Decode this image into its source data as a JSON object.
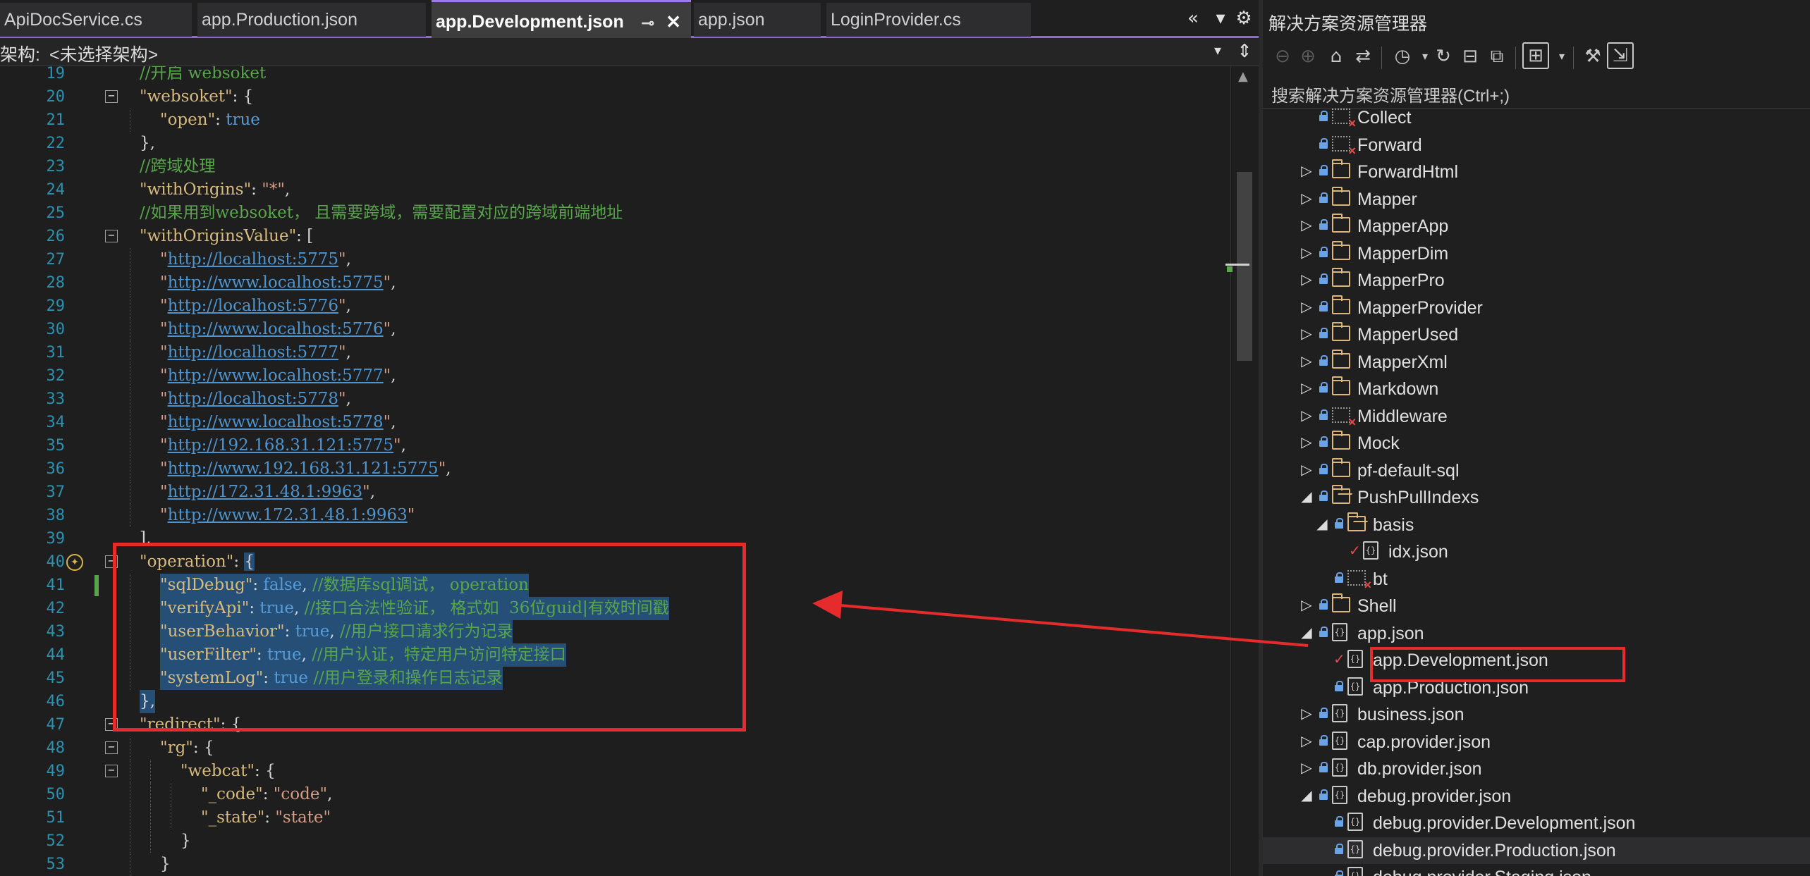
{
  "tabs": [
    {
      "label": "ApiDocService.cs",
      "active": false
    },
    {
      "label": "app.Production.json",
      "active": false
    },
    {
      "label": "app.Development.json",
      "active": true
    },
    {
      "label": "app.json",
      "active": false
    },
    {
      "label": "LoginProvider.cs",
      "active": false
    }
  ],
  "tab_controls": {
    "overflow": "«",
    "dropdown": "▾",
    "settings": "⚙"
  },
  "arch_bar": {
    "label": "架构:",
    "value": "<未选择架构>"
  },
  "code_lines": [
    {
      "n": "19",
      "fold": false,
      "indent": 1,
      "parts": [
        {
          "t": "//开启 websoket",
          "c": "com"
        }
      ]
    },
    {
      "n": "20",
      "fold": true,
      "indent": 1,
      "parts": [
        {
          "t": "\"websoket\"",
          "c": "key"
        },
        {
          "t": ": {",
          "c": "pun"
        }
      ]
    },
    {
      "n": "21",
      "fold": false,
      "indent": 2,
      "parts": [
        {
          "t": "\"open\"",
          "c": "key"
        },
        {
          "t": ": ",
          "c": "pun"
        },
        {
          "t": "true",
          "c": "val"
        }
      ]
    },
    {
      "n": "22",
      "fold": false,
      "indent": 1,
      "parts": [
        {
          "t": "},",
          "c": "pun"
        }
      ]
    },
    {
      "n": "23",
      "fold": false,
      "indent": 1,
      "parts": [
        {
          "t": "//跨域处理",
          "c": "com"
        }
      ]
    },
    {
      "n": "24",
      "fold": false,
      "indent": 1,
      "parts": [
        {
          "t": "\"withOrigins\"",
          "c": "key"
        },
        {
          "t": ": ",
          "c": "pun"
        },
        {
          "t": "\"*\"",
          "c": "str"
        },
        {
          "t": ",",
          "c": "pun"
        }
      ]
    },
    {
      "n": "25",
      "fold": false,
      "indent": 1,
      "parts": [
        {
          "t": "//如果用到websoket， 且需要跨域，需要配置对应的跨域前端地址",
          "c": "com"
        }
      ]
    },
    {
      "n": "26",
      "fold": true,
      "indent": 1,
      "parts": [
        {
          "t": "\"withOriginsValue\"",
          "c": "key"
        },
        {
          "t": ": [",
          "c": "pun"
        }
      ]
    },
    {
      "n": "27",
      "fold": false,
      "indent": 2,
      "parts": [
        {
          "t": "\"",
          "c": "str"
        },
        {
          "t": "http://localhost:5775",
          "c": "url"
        },
        {
          "t": "\"",
          "c": "str"
        },
        {
          "t": ",",
          "c": "pun"
        }
      ]
    },
    {
      "n": "28",
      "fold": false,
      "indent": 2,
      "parts": [
        {
          "t": "\"",
          "c": "str"
        },
        {
          "t": "http://www.localhost:5775",
          "c": "url"
        },
        {
          "t": "\"",
          "c": "str"
        },
        {
          "t": ",",
          "c": "pun"
        }
      ]
    },
    {
      "n": "29",
      "fold": false,
      "indent": 2,
      "parts": [
        {
          "t": "\"",
          "c": "str"
        },
        {
          "t": "http://localhost:5776",
          "c": "url"
        },
        {
          "t": "\"",
          "c": "str"
        },
        {
          "t": ",",
          "c": "pun"
        }
      ]
    },
    {
      "n": "30",
      "fold": false,
      "indent": 2,
      "parts": [
        {
          "t": "\"",
          "c": "str"
        },
        {
          "t": "http://www.localhost:5776",
          "c": "url"
        },
        {
          "t": "\"",
          "c": "str"
        },
        {
          "t": ",",
          "c": "pun"
        }
      ]
    },
    {
      "n": "31",
      "fold": false,
      "indent": 2,
      "parts": [
        {
          "t": "\"",
          "c": "str"
        },
        {
          "t": "http://localhost:5777",
          "c": "url"
        },
        {
          "t": "\"",
          "c": "str"
        },
        {
          "t": ",",
          "c": "pun"
        }
      ]
    },
    {
      "n": "32",
      "fold": false,
      "indent": 2,
      "parts": [
        {
          "t": "\"",
          "c": "str"
        },
        {
          "t": "http://www.localhost:5777",
          "c": "url"
        },
        {
          "t": "\"",
          "c": "str"
        },
        {
          "t": ",",
          "c": "pun"
        }
      ]
    },
    {
      "n": "33",
      "fold": false,
      "indent": 2,
      "parts": [
        {
          "t": "\"",
          "c": "str"
        },
        {
          "t": "http://localhost:5778",
          "c": "url"
        },
        {
          "t": "\"",
          "c": "str"
        },
        {
          "t": ",",
          "c": "pun"
        }
      ]
    },
    {
      "n": "34",
      "fold": false,
      "indent": 2,
      "parts": [
        {
          "t": "\"",
          "c": "str"
        },
        {
          "t": "http://www.localhost:5778",
          "c": "url"
        },
        {
          "t": "\"",
          "c": "str"
        },
        {
          "t": ",",
          "c": "pun"
        }
      ]
    },
    {
      "n": "35",
      "fold": false,
      "indent": 2,
      "parts": [
        {
          "t": "\"",
          "c": "str"
        },
        {
          "t": "http://192.168.31.121:5775",
          "c": "url"
        },
        {
          "t": "\"",
          "c": "str"
        },
        {
          "t": ",",
          "c": "pun"
        }
      ]
    },
    {
      "n": "36",
      "fold": false,
      "indent": 2,
      "parts": [
        {
          "t": "\"",
          "c": "str"
        },
        {
          "t": "http://www.192.168.31.121:5775",
          "c": "url"
        },
        {
          "t": "\"",
          "c": "str"
        },
        {
          "t": ",",
          "c": "pun"
        }
      ]
    },
    {
      "n": "37",
      "fold": false,
      "indent": 2,
      "parts": [
        {
          "t": "\"",
          "c": "str"
        },
        {
          "t": "http://172.31.48.1:9963",
          "c": "url"
        },
        {
          "t": "\"",
          "c": "str"
        },
        {
          "t": ",",
          "c": "pun"
        }
      ]
    },
    {
      "n": "38",
      "fold": false,
      "indent": 2,
      "parts": [
        {
          "t": "\"",
          "c": "str"
        },
        {
          "t": "http://www.172.31.48.1:9963",
          "c": "url"
        },
        {
          "t": "\"",
          "c": "str"
        }
      ]
    },
    {
      "n": "39",
      "fold": false,
      "indent": 1,
      "parts": [
        {
          "t": "],",
          "c": "pun"
        }
      ]
    },
    {
      "n": "40",
      "fold": true,
      "indent": 1,
      "bulb": true,
      "parts": [
        {
          "t": "\"operation\"",
          "c": "key"
        },
        {
          "t": ": ",
          "c": "pun"
        },
        {
          "t": "{",
          "c": "pun",
          "sel": true
        }
      ]
    },
    {
      "n": "41",
      "fold": false,
      "indent": 2,
      "change": true,
      "sel": true,
      "parts": [
        {
          "t": "\"sqlDebug\"",
          "c": "key"
        },
        {
          "t": ": ",
          "c": "pun"
        },
        {
          "t": "false",
          "c": "val"
        },
        {
          "t": ", ",
          "c": "pun"
        },
        {
          "t": "//数据库sql调试， operation",
          "c": "com"
        }
      ]
    },
    {
      "n": "42",
      "fold": false,
      "indent": 2,
      "sel": true,
      "parts": [
        {
          "t": "\"verifyApi\"",
          "c": "key"
        },
        {
          "t": ": ",
          "c": "pun"
        },
        {
          "t": "true",
          "c": "val"
        },
        {
          "t": ", ",
          "c": "pun"
        },
        {
          "t": "//接口合法性验证， 格式如  36位guid|有效时间戳",
          "c": "com"
        }
      ]
    },
    {
      "n": "43",
      "fold": false,
      "indent": 2,
      "sel": true,
      "parts": [
        {
          "t": "\"userBehavior\"",
          "c": "key"
        },
        {
          "t": ": ",
          "c": "pun"
        },
        {
          "t": "true",
          "c": "val"
        },
        {
          "t": ", ",
          "c": "pun"
        },
        {
          "t": "//用户接口请求行为记录",
          "c": "com"
        }
      ]
    },
    {
      "n": "44",
      "fold": false,
      "indent": 2,
      "sel": true,
      "parts": [
        {
          "t": "\"userFilter\"",
          "c": "key"
        },
        {
          "t": ": ",
          "c": "pun"
        },
        {
          "t": "true",
          "c": "val"
        },
        {
          "t": ", ",
          "c": "pun"
        },
        {
          "t": "//用户认证，特定用户访问特定接口",
          "c": "com"
        }
      ]
    },
    {
      "n": "45",
      "fold": false,
      "indent": 2,
      "sel": true,
      "parts": [
        {
          "t": "\"systemLog\"",
          "c": "key"
        },
        {
          "t": ": ",
          "c": "pun"
        },
        {
          "t": "true",
          "c": "val"
        },
        {
          "t": " ",
          "c": "pun"
        },
        {
          "t": "//用户登录和操作日志记录",
          "c": "com"
        }
      ]
    },
    {
      "n": "46",
      "fold": false,
      "indent": 1,
      "sel": true,
      "parts": [
        {
          "t": "},",
          "c": "pun"
        }
      ]
    },
    {
      "n": "47",
      "fold": true,
      "indent": 1,
      "parts": [
        {
          "t": "\"redirect\"",
          "c": "key"
        },
        {
          "t": ": {",
          "c": "pun"
        }
      ]
    },
    {
      "n": "48",
      "fold": true,
      "indent": 2,
      "parts": [
        {
          "t": "\"rg\"",
          "c": "key"
        },
        {
          "t": ": {",
          "c": "pun"
        }
      ]
    },
    {
      "n": "49",
      "fold": true,
      "indent": 3,
      "parts": [
        {
          "t": "\"webcat\"",
          "c": "key"
        },
        {
          "t": ": {",
          "c": "pun"
        }
      ]
    },
    {
      "n": "50",
      "fold": false,
      "indent": 4,
      "parts": [
        {
          "t": "\"_code\"",
          "c": "key"
        },
        {
          "t": ": ",
          "c": "pun"
        },
        {
          "t": "\"code\"",
          "c": "str"
        },
        {
          "t": ",",
          "c": "pun"
        }
      ]
    },
    {
      "n": "51",
      "fold": false,
      "indent": 4,
      "parts": [
        {
          "t": "\"_state\"",
          "c": "key"
        },
        {
          "t": ": ",
          "c": "pun"
        },
        {
          "t": "\"state\"",
          "c": "str"
        }
      ]
    },
    {
      "n": "52",
      "fold": false,
      "indent": 3,
      "parts": [
        {
          "t": "}",
          "c": "pun"
        }
      ]
    },
    {
      "n": "53",
      "fold": false,
      "indent": 2,
      "parts": [
        {
          "t": "}",
          "c": "pun"
        }
      ]
    }
  ],
  "solution_explorer": {
    "title": "解决方案资源管理器",
    "search_label": "搜索解决方案资源管理器(Ctrl+;)",
    "toolbar_icons": [
      "back-icon",
      "forward-icon",
      "home-icon",
      "vs-switch-icon",
      "history-icon",
      "sync-icon",
      "collapse-icon",
      "copy-icon",
      "view-icon",
      "wrench-icon",
      "preview-icon"
    ],
    "nodes": [
      {
        "label": "Collect",
        "level": 3,
        "icon": "folder-excluded",
        "expander": "",
        "lock": true
      },
      {
        "label": "Forward",
        "level": 3,
        "icon": "folder-excluded",
        "expander": "",
        "lock": true
      },
      {
        "label": "ForwardHtml",
        "level": 3,
        "icon": "folder",
        "expander": "▷",
        "lock": true
      },
      {
        "label": "Mapper",
        "level": 3,
        "icon": "folder",
        "expander": "▷",
        "lock": true
      },
      {
        "label": "MapperApp",
        "level": 3,
        "icon": "folder",
        "expander": "▷",
        "lock": true
      },
      {
        "label": "MapperDim",
        "level": 3,
        "icon": "folder",
        "expander": "▷",
        "lock": true
      },
      {
        "label": "MapperPro",
        "level": 3,
        "icon": "folder",
        "expander": "▷",
        "lock": true
      },
      {
        "label": "MapperProvider",
        "level": 3,
        "icon": "folder",
        "expander": "▷",
        "lock": true
      },
      {
        "label": "MapperUsed",
        "level": 3,
        "icon": "folder",
        "expander": "▷",
        "lock": true
      },
      {
        "label": "MapperXml",
        "level": 3,
        "icon": "folder",
        "expander": "▷",
        "lock": true
      },
      {
        "label": "Markdown",
        "level": 3,
        "icon": "folder",
        "expander": "▷",
        "lock": true
      },
      {
        "label": "Middleware",
        "level": 3,
        "icon": "folder-excluded",
        "expander": "▷",
        "lock": true
      },
      {
        "label": "Mock",
        "level": 3,
        "icon": "folder",
        "expander": "▷",
        "lock": true
      },
      {
        "label": "pf-default-sql",
        "level": 3,
        "icon": "folder",
        "expander": "▷",
        "lock": true
      },
      {
        "label": "PushPullIndexs",
        "level": 3,
        "icon": "folder-open",
        "expander": "◢",
        "lock": true
      },
      {
        "label": "basis",
        "level": 4,
        "icon": "folder-open",
        "expander": "◢",
        "lock": true
      },
      {
        "label": "idx.json",
        "level": 5,
        "icon": "json",
        "expander": "",
        "check": true
      },
      {
        "label": "bt",
        "level": 4,
        "icon": "folder-excluded",
        "expander": "",
        "lock": true
      },
      {
        "label": "Shell",
        "level": 3,
        "icon": "folder",
        "expander": "▷",
        "lock": true
      },
      {
        "label": "app.json",
        "level": 3,
        "icon": "json",
        "expander": "◢",
        "lock": true
      },
      {
        "label": "app.Development.json",
        "level": 4,
        "icon": "json",
        "expander": "",
        "check": true
      },
      {
        "label": "app.Production.json",
        "level": 4,
        "icon": "json",
        "expander": "",
        "lock": true
      },
      {
        "label": "business.json",
        "level": 3,
        "icon": "json",
        "expander": "▷",
        "lock": true
      },
      {
        "label": "cap.provider.json",
        "level": 3,
        "icon": "json",
        "expander": "▷",
        "lock": true
      },
      {
        "label": "db.provider.json",
        "level": 3,
        "icon": "json",
        "expander": "▷",
        "lock": true
      },
      {
        "label": "debug.provider.json",
        "level": 3,
        "icon": "json",
        "expander": "◢",
        "lock": true
      },
      {
        "label": "debug.provider.Development.json",
        "level": 4,
        "icon": "json",
        "expander": "",
        "lock": true
      },
      {
        "label": "debug.provider.Production.json",
        "level": 4,
        "icon": "json",
        "expander": "",
        "lock": true,
        "highlight": true
      },
      {
        "label": "debug.provider.Staging.json",
        "level": 4,
        "icon": "json",
        "expander": "",
        "lock": true
      }
    ]
  },
  "colors": {
    "accent": "#8c67d6",
    "annotation_red": "#e52b2b",
    "selection": "#264f78",
    "comment": "#57a64a",
    "json_key": "#d7ba7d",
    "string": "#d69d85",
    "keyword": "#569cd6",
    "line_number": "#2b91af"
  }
}
